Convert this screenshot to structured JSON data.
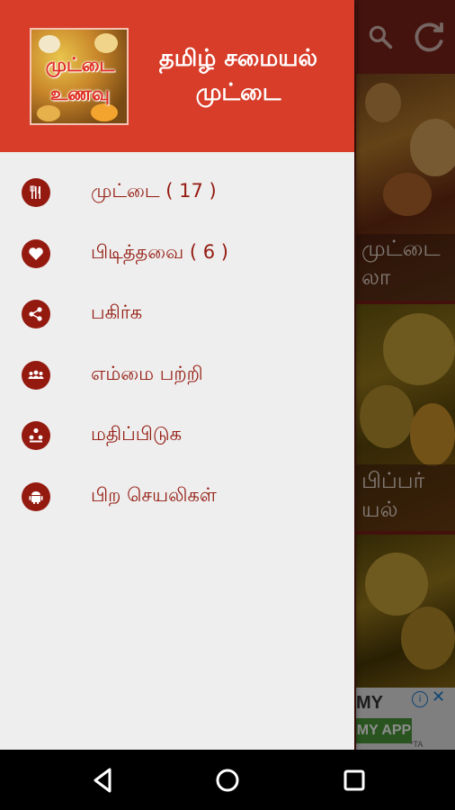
{
  "drawer": {
    "header_title_line1": "தமிழ் சமையல்",
    "header_title_line2": "முட்டை",
    "logo_line1": "முட்டை",
    "logo_line2": "உணவு",
    "items": [
      {
        "label": "முட்டை ( 17 )",
        "icon": "restaurant-icon"
      },
      {
        "label": "பிடித்தவை ( 6 )",
        "icon": "heart-icon"
      },
      {
        "label": "பகிர்க",
        "icon": "share-icon"
      },
      {
        "label": "எம்மை பற்றி",
        "icon": "group-icon"
      },
      {
        "label": "மதிப்பிடுக",
        "icon": "rate-icon"
      },
      {
        "label": "பிற செயலிகள்",
        "icon": "android-icon"
      }
    ]
  },
  "background": {
    "card1_line1": "முட்டை",
    "card1_line2": "லா",
    "card2_line1": "பிப்பர்",
    "card2_line2": "யல்",
    "ad_text": "MY",
    "ad_button": "MY APP",
    "ad_small": "*TA"
  },
  "colors": {
    "header": "#d83d2a",
    "accent": "#941a10",
    "drawer_bg": "#eeeeee"
  },
  "navbar": {
    "icons": [
      "back-icon",
      "home-icon",
      "recents-icon"
    ]
  }
}
